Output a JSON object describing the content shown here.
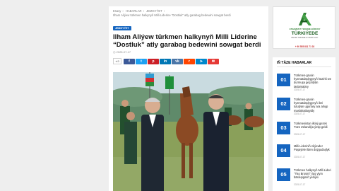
{
  "breadcrumb": {
    "items": [
      "Esasy",
      "HABARLAR",
      "JEMGYÝET",
      "Ilham Aliýew türkmen halkynyň Milli Liderine \"Dostluk\" atly garabag bedewini sowgat berdi"
    ]
  },
  "article": {
    "category": "JEMGYÝET",
    "title": "Ilham Aliýew türkmen halkynyň Milli Liderine “Dostluk” atly garabag bedewini sowgat berdi",
    "date": "2025-07-17",
    "share_count": "0",
    "share_buttons": [
      {
        "icon": "facebook-icon",
        "glyph": "f",
        "color": "#3b5998"
      },
      {
        "icon": "twitter-icon",
        "glyph": "t",
        "color": "#1da1f2"
      },
      {
        "icon": "pinterest-icon",
        "glyph": "p",
        "color": "#cb2027"
      },
      {
        "icon": "linkedin-icon",
        "glyph": "in",
        "color": "#0077b5"
      },
      {
        "icon": "vk-icon",
        "glyph": "vk",
        "color": "#4a76a8"
      },
      {
        "icon": "reddit-icon",
        "glyph": "r",
        "color": "#ff4500"
      },
      {
        "icon": "telegram-icon",
        "glyph": "➤",
        "color": "#0088cc"
      },
      {
        "icon": "email-icon",
        "glyph": "✉",
        "color": "#e53935"
      }
    ]
  },
  "ad": {
    "logo_letters": "AD",
    "subtitle": "ATNAMENT TERJIME BÜROSY",
    "name": "TÜRKIÝEDE",
    "tagline": "RESMI TERJIME HYZMATLARY",
    "phone": "+ 90 555 831 71 02"
  },
  "sidebar": {
    "heading": "IŇ TÄZE HABARLAR",
    "items": [
      {
        "num": "01",
        "title": "Türkmen-grusin hyzmatdaşlygynyň häzirki we durmuşa geçirilýän taslamalary",
        "date": "2025-07-17"
      },
      {
        "num": "02",
        "title": "Türkmen-grusin hyzmatdaşlygynyň ileri tutulýan ugurlary ara alnyp maslahatlaşyldy",
        "date": "2025-07-17"
      },
      {
        "num": "03",
        "title": "Türkmenistan ilkinji gezek Tüze Zelandiýa ýetip geldi",
        "date": "2025-07-17"
      },
      {
        "num": "04",
        "title": "Milli Lideriniň Aliýewler Paşaýele Ilden duýgudaşlyk",
        "date": "2025-07-17"
      },
      {
        "num": "05",
        "title": "Türkmen halkynyň Milli Lideri \"Ýaş Brosmi\" ýaş ylym bäsleşiginiň ýeňijisi",
        "date": "2025-07-17"
      }
    ]
  }
}
